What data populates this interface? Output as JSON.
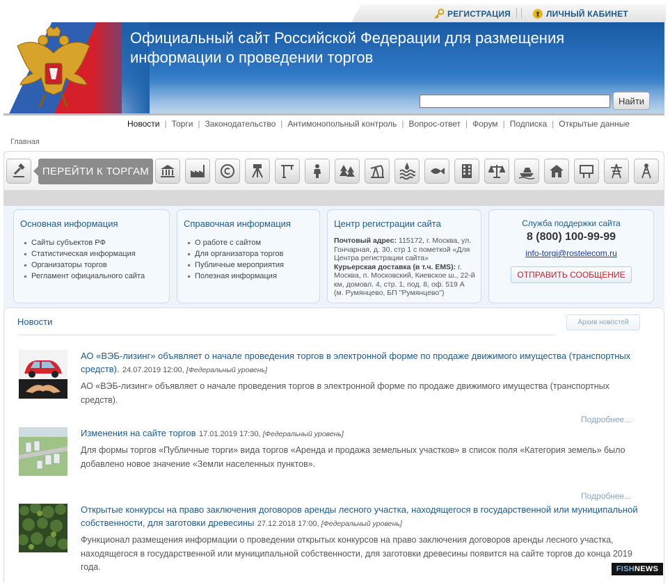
{
  "topbar": {
    "registration": "РЕГИСТРАЦИЯ",
    "cabinet": "ЛИЧНЫЙ КАБИНЕТ"
  },
  "header": {
    "title_line1": "Официальный сайт Российской Федерации для размещения",
    "title_line2": "информации о проведении торгов",
    "search_value": "",
    "search_button": "Найти"
  },
  "nav": {
    "items": [
      "Новости",
      "Торги",
      "Законодательство",
      "Антимонопольный контроль",
      "Вопрос-ответ",
      "Форум",
      "Подписка",
      "Открытые данные"
    ],
    "active": "Новости"
  },
  "breadcrumb": "Главная",
  "categories": {
    "go_button": "ПЕРЕЙТИ К ТОРГАМ",
    "icons": [
      "gavel-icon",
      "bank-building-icon",
      "factory-icon",
      "copyright-icon",
      "surveyor-tripod-icon",
      "construction-crane-icon",
      "worker-icon",
      "forest-icon",
      "oil-pump-icon",
      "water-resources-icon",
      "fish-icon",
      "apartment-building-icon",
      "scales-icon",
      "boat-icon",
      "house-icon",
      "billboard-icon",
      "power-line-icon",
      "radio-tower-icon"
    ]
  },
  "panels": {
    "basic": {
      "title": "Основная информация",
      "items": [
        "Сайты субъектов РФ",
        "Статистическая информация",
        "Организаторы торгов",
        "Регламент официального сайта"
      ]
    },
    "reference": {
      "title": "Справочная информация",
      "items": [
        "О работе с сайтом",
        "Для организатора торгов",
        "Публичные мероприятия",
        "Полезная информация"
      ]
    },
    "registration": {
      "title": "Центр регистрации сайта",
      "postal_label": "Почтовый адрес:",
      "postal_text": " 115172, г. Москва, ул. Гончарная, д. 30, стр 1 с пометкой «Для Центра регистрации сайта»",
      "courier_label": "Курьерская доставка (в т.ч. EMS):",
      "courier_text": " г. Москва, п. Московский, Киевское ш., 22-й км, домовл. 4, стр. 1, под. 8, оф. 519 А (м. Румянцево, БП \"Румянцево\")"
    },
    "support": {
      "title": "Служба поддержки сайта",
      "phone": "8 (800) 100-99-99",
      "email": "info-torgi@rostelecom.ru",
      "send_button": "ОТПРАВИТЬ СООБЩЕНИЕ"
    }
  },
  "news": {
    "title": "Новости",
    "archive_button": "Архив новостей",
    "more_label": "Подробнее...",
    "items": [
      {
        "headline": "АО «ВЭБ-лизинг» объявляет о начале проведения торгов в электронной форме по продаже движимого имущества (транспортных средств).",
        "date": "24.07.2019 12:00",
        "level": "[Федеральный уровень]",
        "body": "АО «ВЭБ-лизинг» объявляет о начале проведения торгов в электронной форме по продаже движимого имущества (транспортных средств)."
      },
      {
        "headline": "Изменения на сайте торгов",
        "date": "17.01.2019 17:30",
        "level": "[Федеральный уровень]",
        "body": "Для формы торгов «Публичные торги» вида торгов «Аренда и продажа земельных участков» в список поля «Категория земель» было добавлено новое значение «Земли населенных пунктов»."
      },
      {
        "headline": "Открытые конкурсы на право заключения договоров аренды лесного участка, находящегося в государственной или муниципальной собственности, для заготовки древесины",
        "date": "27.12.2018 17:00",
        "level": "[Федеральный уровень]",
        "body": "Функционал размещения информации о проведении открытых конкурсов на право заключения договоров аренды лесного участка, находящегося в государственной или муниципальной собственности, для заготовки древесины появится на сайте торгов до конца 2019 года."
      }
    ]
  },
  "watermark": {
    "part1": "FISH",
    "part2": "NEWS"
  }
}
